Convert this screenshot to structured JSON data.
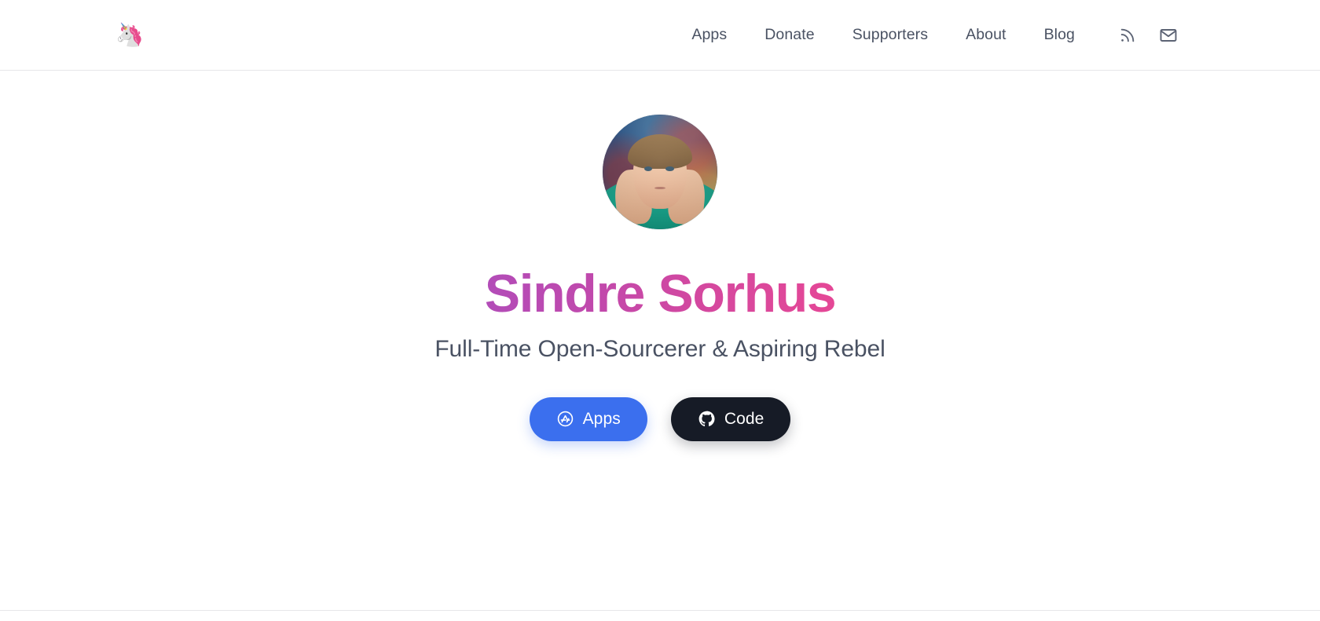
{
  "header": {
    "logo": {
      "name": "unicorn-logo",
      "glyph": "🦄"
    },
    "nav": [
      {
        "label": "Apps",
        "name": "nav-link-apps"
      },
      {
        "label": "Donate",
        "name": "nav-link-donate"
      },
      {
        "label": "Supporters",
        "name": "nav-link-supporters"
      },
      {
        "label": "About",
        "name": "nav-link-about"
      },
      {
        "label": "Blog",
        "name": "nav-link-blog"
      }
    ],
    "icons": [
      {
        "name": "rss-icon",
        "title": "RSS feed"
      },
      {
        "name": "mail-icon",
        "title": "Newsletter"
      }
    ]
  },
  "hero": {
    "avatar_alt": "Sindre Sorhus profile photo",
    "title": "Sindre Sorhus",
    "tagline": "Full-Time Open-Sourcerer & Aspiring Rebel",
    "buttons": [
      {
        "label": "Apps",
        "icon": "app-store-icon",
        "name": "apps-button"
      },
      {
        "label": "Code",
        "icon": "github-icon",
        "name": "code-button"
      }
    ]
  },
  "colors": {
    "page_background": "#ffffff",
    "nav_text": "#4a5263",
    "border": "#e6e7e9",
    "title_gradient_start": "#b24cb8",
    "title_gradient_end": "#e54796",
    "apps_button": "#3b6fee",
    "code_button": "#161b26",
    "tagline_text": "#4a5263"
  }
}
